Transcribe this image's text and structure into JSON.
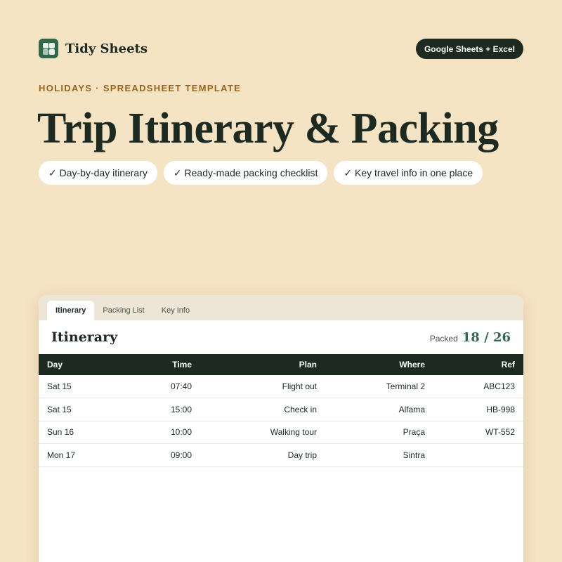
{
  "brand": {
    "name": "Tidy Sheets",
    "logo_icon": "grid-logo-icon",
    "accent": "#2f6b4a"
  },
  "platform_badge": "Google Sheets + Excel",
  "eyebrow": "HOLIDAYS · SPREADSHEET TEMPLATE",
  "headline": "Trip Itinerary & Packing",
  "features": [
    "✓ Day-by-day itinerary",
    "✓ Ready-made packing checklist",
    "✓ Key travel info in one place"
  ],
  "sheet": {
    "tabs": [
      {
        "label": "Itinerary",
        "active": true
      },
      {
        "label": "Packing List",
        "active": false
      },
      {
        "label": "Key Info",
        "active": false
      }
    ],
    "title": "Itinerary",
    "packed_label": "Packed",
    "packed_value": "18 / 26",
    "columns": [
      "Day",
      "Time",
      "Plan",
      "Where",
      "Ref"
    ],
    "rows": [
      [
        "Sat 15",
        "07:40",
        "Flight out",
        "Terminal 2",
        "ABC123"
      ],
      [
        "Sat 15",
        "15:00",
        "Check in",
        "Alfama",
        "HB-998"
      ],
      [
        "Sun 16",
        "10:00",
        "Walking tour",
        "Praça",
        "WT-552"
      ],
      [
        "Mon 17",
        "09:00",
        "Day trip",
        "Sintra",
        ""
      ]
    ]
  },
  "colors": {
    "background": "#f5e4c4",
    "ink": "#1c2a22",
    "eyebrow": "#9a6418",
    "tabbar": "#ede5d6"
  }
}
